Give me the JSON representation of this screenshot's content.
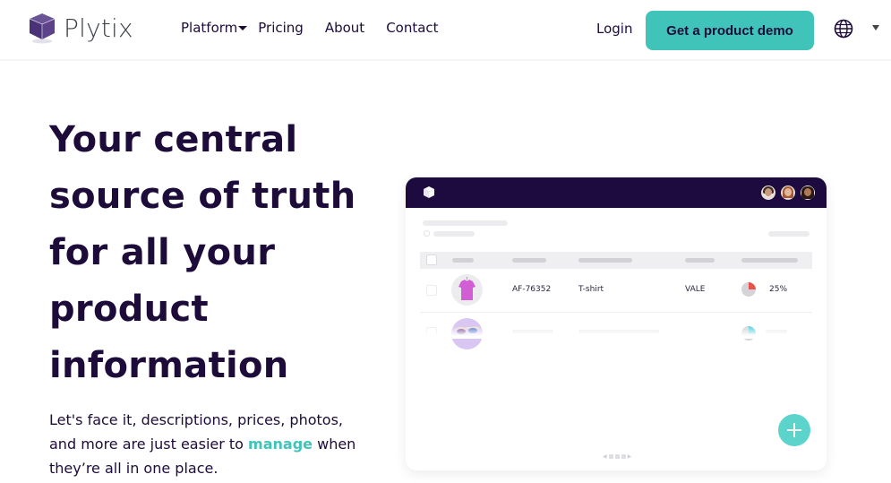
{
  "header": {
    "brand": "Plytix",
    "nav": [
      {
        "label": "Platform",
        "has_dropdown": true
      },
      {
        "label": "Pricing"
      },
      {
        "label": "About"
      },
      {
        "label": "Contact"
      }
    ],
    "login_label": "Login",
    "cta_label": "Get a product demo",
    "language_icon": "globe-icon"
  },
  "hero": {
    "title_lines": [
      "Your central",
      "source of truth",
      "for all your",
      "product",
      "information"
    ],
    "subtitle_before": "Let's face it, descriptions, prices, photos, and more are just easier to ",
    "subtitle_accent": "manage",
    "subtitle_after": " when they’re all in one place."
  },
  "mockup": {
    "rows": [
      {
        "sku": "AF-76352",
        "name": "T-shirt",
        "brand": "VALE",
        "completeness": "25%",
        "completeness_value": 0.25,
        "pie_color": "#e9524a"
      },
      {
        "sku": "",
        "name": "",
        "brand": "",
        "completeness": "",
        "pie_color": "#5ccfe0"
      }
    ],
    "fab_icon": "plus-icon"
  },
  "colors": {
    "brand_dark": "#1d0c3a",
    "accent": "#40c4b9",
    "mock_bar": "#1d0a3e"
  }
}
